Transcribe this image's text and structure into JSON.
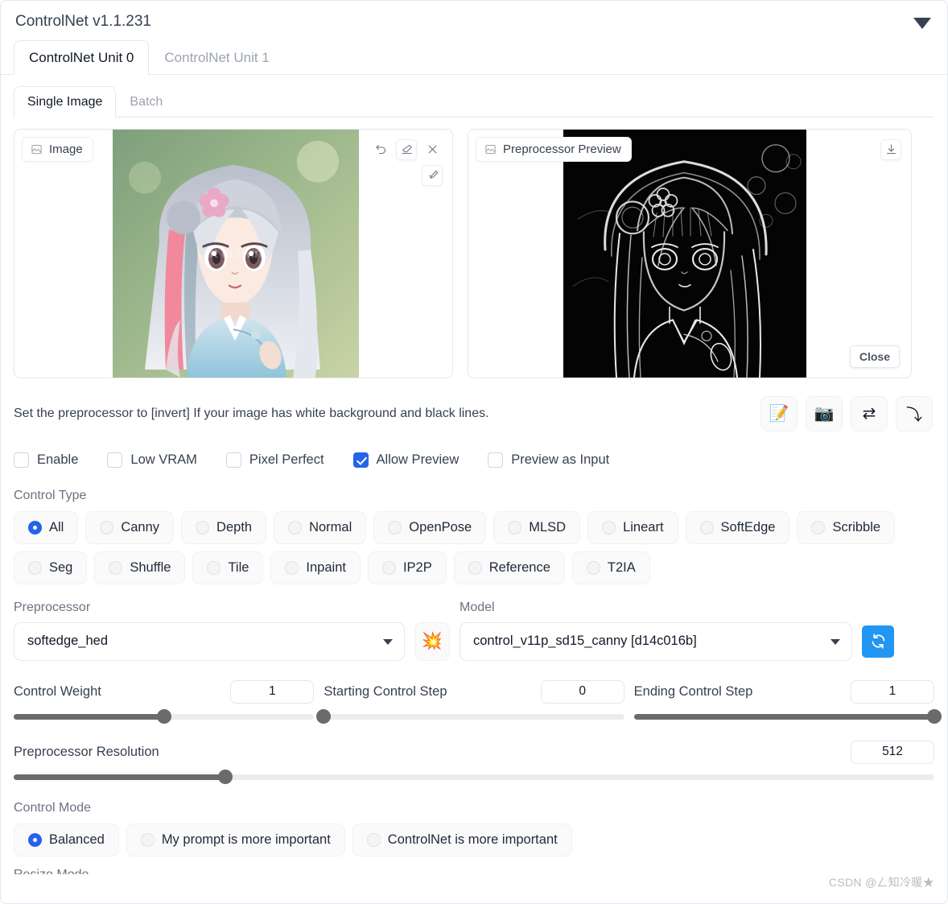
{
  "accordion": {
    "title": "ControlNet v1.1.231",
    "collapse_icon": "triangle-down-icon"
  },
  "unit_tabs": [
    {
      "label": "ControlNet Unit 0",
      "active": true
    },
    {
      "label": "ControlNet Unit 1",
      "active": false
    }
  ],
  "source_tabs": [
    {
      "label": "Single Image",
      "active": true
    },
    {
      "label": "Batch",
      "active": false
    }
  ],
  "image_panel": {
    "label": "Image",
    "label_icon": "image-icon",
    "tools": [
      {
        "name": "undo-icon",
        "glyph": "undo"
      },
      {
        "name": "eraser-icon",
        "glyph": "eraser"
      },
      {
        "name": "close-icon",
        "glyph": "close"
      },
      {
        "name": "brush-icon",
        "glyph": "brush"
      }
    ]
  },
  "preview_panel": {
    "label": "Preprocessor Preview",
    "label_icon": "image-icon",
    "download_icon": "download-icon",
    "close_label": "Close"
  },
  "hint": {
    "text": "Set the preprocessor to [invert] If your image has white background and black lines."
  },
  "action_buttons": [
    {
      "name": "send-to-txt2img-button",
      "glyph": "📝"
    },
    {
      "name": "webcam-button",
      "glyph": "📷"
    },
    {
      "name": "swap-button",
      "glyph": "⇄"
    },
    {
      "name": "send-dimensions-button",
      "glyph": "⤵"
    }
  ],
  "checkboxes": [
    {
      "label": "Enable",
      "checked": false
    },
    {
      "label": "Low VRAM",
      "checked": false
    },
    {
      "label": "Pixel Perfect",
      "checked": false
    },
    {
      "label": "Allow Preview",
      "checked": true
    },
    {
      "label": "Preview as Input",
      "checked": false
    }
  ],
  "control_type": {
    "label": "Control Type",
    "row1": [
      {
        "label": "All",
        "selected": true
      },
      {
        "label": "Canny",
        "selected": false
      },
      {
        "label": "Depth",
        "selected": false
      },
      {
        "label": "Normal",
        "selected": false
      },
      {
        "label": "OpenPose",
        "selected": false
      },
      {
        "label": "MLSD",
        "selected": false
      },
      {
        "label": "Lineart",
        "selected": false
      },
      {
        "label": "SoftEdge",
        "selected": false
      },
      {
        "label": "Scribble",
        "selected": false
      }
    ],
    "row2": [
      {
        "label": "Seg",
        "selected": false
      },
      {
        "label": "Shuffle",
        "selected": false
      },
      {
        "label": "Tile",
        "selected": false
      },
      {
        "label": "Inpaint",
        "selected": false
      },
      {
        "label": "IP2P",
        "selected": false
      },
      {
        "label": "Reference",
        "selected": false
      },
      {
        "label": "T2IA",
        "selected": false
      }
    ]
  },
  "preprocessor": {
    "label": "Preprocessor",
    "value": "softedge_hed",
    "run_button_glyph": "💥"
  },
  "model": {
    "label": "Model",
    "value": "control_v11p_sd15_canny [d14c016b]",
    "refresh_icon": "refresh-icon"
  },
  "sliders": [
    {
      "label": "Control Weight",
      "value": "1",
      "percent": 50
    },
    {
      "label": "Starting Control Step",
      "value": "0",
      "percent": 0
    },
    {
      "label": "Ending Control Step",
      "value": "1",
      "percent": 100
    }
  ],
  "resolution": {
    "label": "Preprocessor Resolution",
    "value": "512",
    "percent": 23
  },
  "control_mode": {
    "label": "Control Mode",
    "options": [
      {
        "label": "Balanced",
        "selected": true
      },
      {
        "label": "My prompt is more important",
        "selected": false
      },
      {
        "label": "ControlNet is more important",
        "selected": false
      }
    ]
  },
  "cutoff_label": "Resize Mode",
  "watermark": "CSDN @ㄥ知冷暖★",
  "colors": {
    "accent": "#2563eb",
    "refresh": "#2196f3",
    "slider_fill": "#6b6b6b",
    "text": "#374151",
    "muted": "#6b7280"
  }
}
